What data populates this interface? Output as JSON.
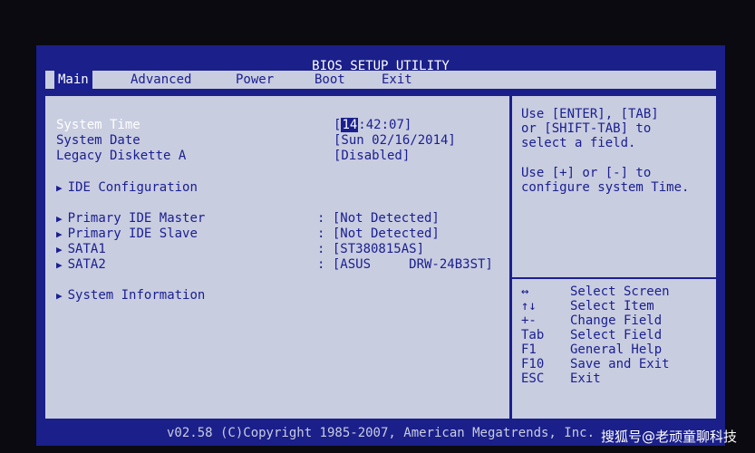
{
  "title": "BIOS SETUP UTILITY",
  "menu": [
    {
      "label": "Main",
      "active": true
    },
    {
      "label": "Advanced",
      "active": false
    },
    {
      "label": "Power",
      "active": false
    },
    {
      "label": "Boot",
      "active": false
    },
    {
      "label": "Exit",
      "active": false
    }
  ],
  "settings": {
    "system_time": {
      "label": "System Time",
      "hour": "14",
      "rest": ":42:07]"
    },
    "system_date": {
      "label": "System Date",
      "value": "[Sun 02/16/2014]"
    },
    "legacy_diskette": {
      "label": "Legacy Diskette A",
      "value": "[Disabled]"
    },
    "ide_config": {
      "label": "IDE Configuration"
    },
    "primary_master": {
      "label": "Primary IDE Master",
      "value": "[Not Detected]"
    },
    "primary_slave": {
      "label": "Primary IDE Slave",
      "value": "[Not Detected]"
    },
    "sata1": {
      "label": "SATA1",
      "value": "[ST380815AS]"
    },
    "sata2": {
      "label": "SATA2",
      "value": "[ASUS     DRW-24B3ST]"
    },
    "system_info": {
      "label": "System Information"
    }
  },
  "help": {
    "line1": "Use [ENTER], [TAB]\nor [SHIFT-TAB] to\nselect a field.",
    "line2": "Use [+] or [-] to\nconfigure system Time."
  },
  "keys": [
    {
      "key": "↔",
      "action": "Select Screen"
    },
    {
      "key": "↑↓",
      "action": "Select Item"
    },
    {
      "key": "+-",
      "action": "Change Field"
    },
    {
      "key": "Tab",
      "action": "Select Field"
    },
    {
      "key": "F1",
      "action": "General Help"
    },
    {
      "key": "F10",
      "action": "Save and Exit"
    },
    {
      "key": "ESC",
      "action": "Exit"
    }
  ],
  "footer": "v02.58 (C)Copyright 1985-2007, American Megatrends, Inc.",
  "watermark": "搜狐号@老顽童聊科技",
  "colors": {
    "background": "#1a1f8a",
    "panel": "#c9cde0",
    "text": "#1a2090",
    "highlight": "#ffffff"
  }
}
